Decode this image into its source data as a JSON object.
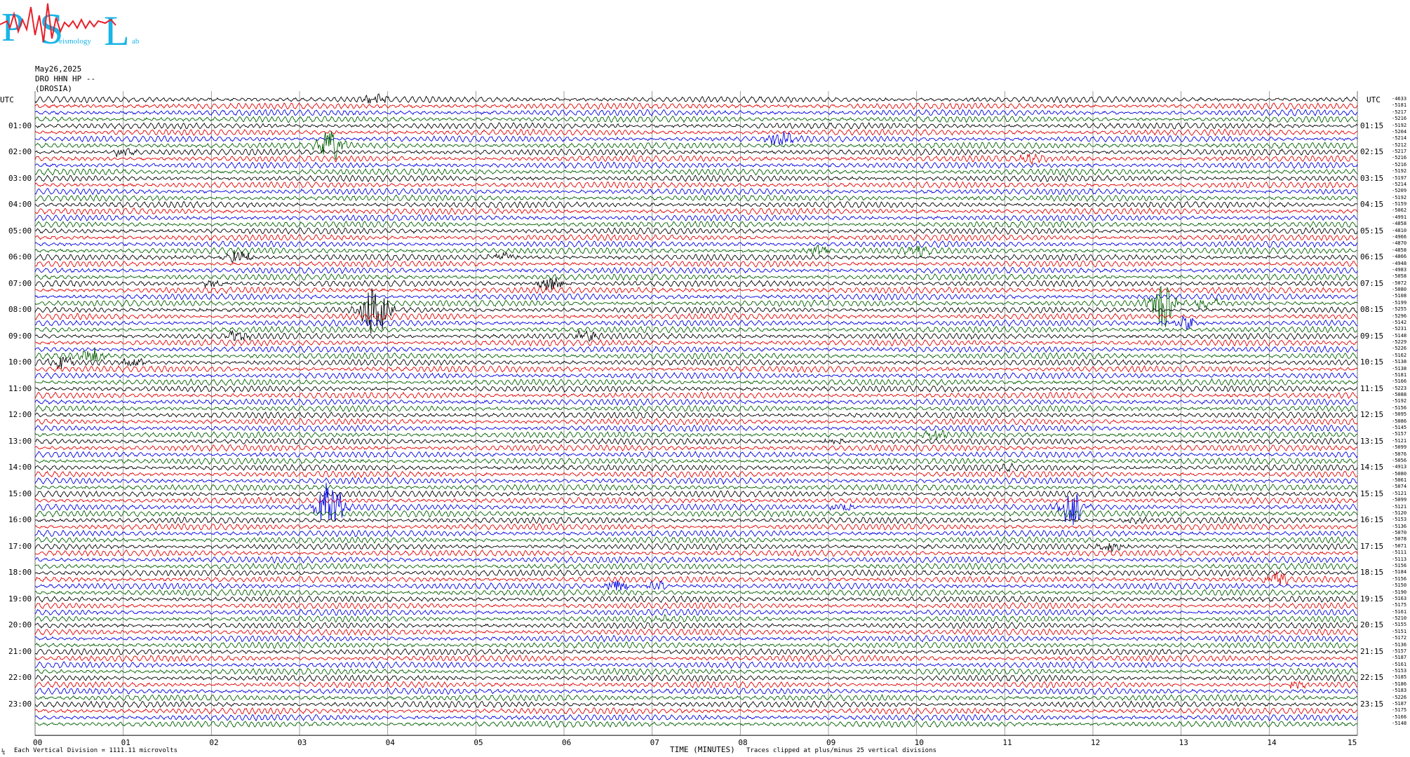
{
  "logo": {
    "letters": [
      "P",
      "S",
      "L"
    ],
    "subtitle_parts": [
      "eismology",
      "ab"
    ]
  },
  "header": {
    "date": "May26,2025",
    "channel": "DRO HHN HP --",
    "station": "(DROSIA)"
  },
  "axis": {
    "utc_left": "UTC",
    "utc_right": "UTC",
    "xlabel": "TIME (MINUTES)",
    "xticks": [
      "00",
      "01",
      "02",
      "03",
      "04",
      "05",
      "06",
      "07",
      "08",
      "09",
      "10",
      "11",
      "12",
      "13",
      "14",
      "15"
    ]
  },
  "footer": {
    "marker": "⅙",
    "scale": "Each Vertical Division = 1111.11 microvolts",
    "clip": "Traces clipped at plus/minus 25 vertical divisions"
  },
  "colors": {
    "trace_cycle": [
      "#000000",
      "#e00000",
      "#0000e0",
      "#006000"
    ],
    "grid": "#888888",
    "logo_blue": "#19b5e8",
    "logo_red": "#e8202a"
  },
  "chart_data": {
    "type": "line",
    "title": "",
    "xlabel": "TIME (MINUTES)",
    "ylabel": "",
    "xlim": [
      0,
      15
    ],
    "num_traces": 96,
    "trace_minutes": 15,
    "left_labels": [
      "01:00",
      "02:00",
      "03:00",
      "04:00",
      "05:00",
      "06:00",
      "07:00",
      "08:00",
      "09:00",
      "10:00",
      "11:00",
      "12:00",
      "13:00",
      "14:00",
      "15:00",
      "16:00",
      "17:00",
      "18:00",
      "19:00",
      "20:00",
      "21:00",
      "22:00",
      "23:00"
    ],
    "right_labels": [
      "01:15",
      "02:15",
      "03:15",
      "04:15",
      "05:15",
      "06:15",
      "07:15",
      "08:15",
      "09:15",
      "10:15",
      "11:15",
      "12:15",
      "13:15",
      "14:15",
      "15:15",
      "16:15",
      "17:15",
      "18:15",
      "19:15",
      "20:15",
      "21:15",
      "22:15",
      "23:15"
    ],
    "trace_offsets": [
      "-4633",
      "-5181",
      "-5217",
      "-5216",
      "-5192",
      "-5204",
      "-5214",
      "-5212",
      "-5217",
      "-5216",
      "-5216",
      "-5192",
      "-5197",
      "-5214",
      "-5209",
      "-5192",
      "-5159",
      "-5062",
      "-4991",
      "-4858",
      "-4810",
      "-4966",
      "-4870",
      "-4858",
      "-4866",
      "-4948",
      "-4983",
      "-5058",
      "-5072",
      "-5080",
      "-5108",
      "-5199",
      "-5255",
      "-5296",
      "-5142",
      "-5231",
      "-5148",
      "-5229",
      "-5226",
      "-5162",
      "-5138",
      "-5138",
      "-5181",
      "-5166",
      "-5223",
      "-5088",
      "-5192",
      "-5156",
      "-5095",
      "-5086",
      "-5145",
      "-5157",
      "-5121",
      "-5099",
      "-5076",
      "-5056",
      "-4913",
      "-5080",
      "-5061",
      "-5074",
      "-5121",
      "-5099",
      "-5121",
      "-5120",
      "-5153",
      "-5136",
      "-5070",
      "-5078",
      "-5071",
      "-5111",
      "-5113",
      "-5156",
      "-5184",
      "-5156",
      "-5150",
      "-5190",
      "-5163",
      "-5175",
      "-5161",
      "-5210",
      "-5155",
      "-5151",
      "-5172",
      "-5136",
      "-5157",
      "-5187",
      "-5161",
      "-5153",
      "-5185",
      "-5186",
      "-5183",
      "-5226",
      "-5187",
      "-5175",
      "-5166",
      "-5148"
    ],
    "events": [
      {
        "trace": 0,
        "minute": 3.85,
        "amplitude": 0.9
      },
      {
        "trace": 7,
        "minute": 3.35,
        "amplitude": 3.0
      },
      {
        "trace": 6,
        "minute": 8.45,
        "amplitude": 1.5
      },
      {
        "trace": 9,
        "minute": 11.3,
        "amplitude": 1.0
      },
      {
        "trace": 8,
        "minute": 1.0,
        "amplitude": 0.8
      },
      {
        "trace": 24,
        "minute": 2.3,
        "amplitude": 1.6
      },
      {
        "trace": 24,
        "minute": 5.3,
        "amplitude": 0.9
      },
      {
        "trace": 23,
        "minute": 8.9,
        "amplitude": 1.0
      },
      {
        "trace": 23,
        "minute": 10.0,
        "amplitude": 0.8
      },
      {
        "trace": 28,
        "minute": 5.85,
        "amplitude": 1.4
      },
      {
        "trace": 28,
        "minute": 2.0,
        "amplitude": 0.7
      },
      {
        "trace": 31,
        "minute": 12.8,
        "amplitude": 5.0
      },
      {
        "trace": 32,
        "minute": 3.85,
        "amplitude": 6.5
      },
      {
        "trace": 31,
        "minute": 13.3,
        "amplitude": 1.2
      },
      {
        "trace": 34,
        "minute": 13.05,
        "amplitude": 1.2
      },
      {
        "trace": 36,
        "minute": 2.3,
        "amplitude": 1.0
      },
      {
        "trace": 36,
        "minute": 6.25,
        "amplitude": 1.0
      },
      {
        "trace": 39,
        "minute": 0.65,
        "amplitude": 1.5
      },
      {
        "trace": 40,
        "minute": 0.3,
        "amplitude": 1.3
      },
      {
        "trace": 40,
        "minute": 1.1,
        "amplitude": 0.9
      },
      {
        "trace": 52,
        "minute": 9.1,
        "amplitude": 0.8
      },
      {
        "trace": 51,
        "minute": 10.2,
        "amplitude": 1.0
      },
      {
        "trace": 56,
        "minute": 11.0,
        "amplitude": 0.6
      },
      {
        "trace": 62,
        "minute": 3.35,
        "amplitude": 6.0
      },
      {
        "trace": 62,
        "minute": 11.75,
        "amplitude": 3.5
      },
      {
        "trace": 62,
        "minute": 9.15,
        "amplitude": 1.0
      },
      {
        "trace": 64,
        "minute": 12.45,
        "amplitude": 0.6
      },
      {
        "trace": 68,
        "minute": 12.2,
        "amplitude": 1.1
      },
      {
        "trace": 73,
        "minute": 14.1,
        "amplitude": 1.4
      },
      {
        "trace": 74,
        "minute": 6.6,
        "amplitude": 1.1
      },
      {
        "trace": 74,
        "minute": 7.05,
        "amplitude": 1.0
      },
      {
        "trace": 89,
        "minute": 14.3,
        "amplitude": 0.7
      },
      {
        "trace": 79,
        "minute": 7.1,
        "amplitude": 0.5
      }
    ]
  }
}
